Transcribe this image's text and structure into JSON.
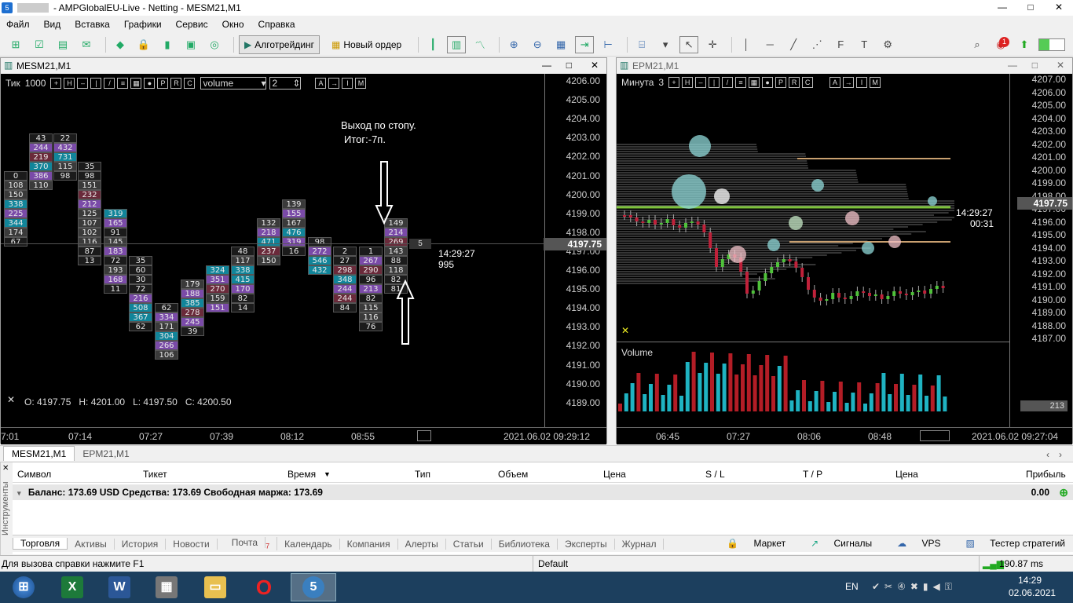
{
  "window": {
    "title": "- AMPGlobalEU-Live - Netting - MESM21,M1",
    "minimize": "—",
    "maximize": "□",
    "close": "✕"
  },
  "menu": [
    "Файл",
    "Вид",
    "Вставка",
    "Графики",
    "Сервис",
    "Окно",
    "Справка"
  ],
  "toolbar": {
    "algo_label": "Алготрейдинг",
    "order_label": "Новый ордер",
    "notif_count": "1"
  },
  "left_chart": {
    "tab": "MESM21,M1",
    "period_label": "Тик",
    "period_value": "1000",
    "indicator_select": "volume",
    "indicator_param": "2",
    "annotation_line1": "Выход по стопу.",
    "annotation_line2": "Итог:-7п.",
    "ohlc": "O: 4197.75   H: 4201.00   L: 4197.50   C: 4200.50",
    "current_price": "4197.75",
    "countdown_time": "14:29:27",
    "countdown_ticks": "995",
    "last_value": "5",
    "price_axis": [
      "4206.00",
      "4205.00",
      "4204.00",
      "4203.00",
      "4202.00",
      "4201.00",
      "4200.00",
      "4199.00",
      "4198.00",
      "4197.00",
      "4196.00",
      "4195.00",
      "4194.00",
      "4193.00",
      "4192.00",
      "4191.00",
      "4190.00",
      "4189.00"
    ],
    "time_axis": [
      "7:01",
      "07:14",
      "07:27",
      "07:39",
      "08:12",
      "08:55"
    ],
    "datetime": "2021.06.02 09:29:12",
    "columns": [
      {
        "vals": [
          "0",
          "108",
          "150",
          "338",
          "225",
          "344",
          "174",
          "67"
        ]
      },
      {
        "vals": [
          "43",
          "244",
          "219",
          "370",
          "386",
          "110"
        ]
      },
      {
        "vals": [
          "22",
          "432",
          "731",
          "115",
          "98"
        ]
      },
      {
        "vals": [
          "35",
          "98",
          "151",
          "232",
          "212",
          "125",
          "107",
          "102",
          "116",
          "87",
          "13"
        ]
      },
      {
        "vals": [
          "319",
          "165",
          "91",
          "145",
          "183",
          "72",
          "193",
          "168",
          "11"
        ]
      },
      {
        "vals": [
          "35",
          "60",
          "30",
          "72",
          "216",
          "508",
          "367",
          "62"
        ]
      },
      {
        "vals": [
          "62",
          "334",
          "171",
          "304",
          "266",
          "106"
        ]
      },
      {
        "vals": [
          "179",
          "188",
          "385",
          "278",
          "245",
          "39"
        ]
      },
      {
        "vals": [
          "324",
          "351",
          "270",
          "159",
          "151"
        ]
      },
      {
        "vals": [
          "48",
          "117",
          "338",
          "415",
          "170",
          "82",
          "14"
        ]
      },
      {
        "vals": [
          "132",
          "218",
          "471",
          "237",
          "150"
        ]
      },
      {
        "vals": [
          "139",
          "155",
          "167",
          "476",
          "319",
          "16"
        ]
      },
      {
        "vals": [
          "98",
          "272",
          "546",
          "432"
        ]
      },
      {
        "vals": [
          "2",
          "27",
          "298",
          "348",
          "244",
          "244",
          "84"
        ]
      },
      {
        "vals": [
          "1",
          "267",
          "290",
          "96",
          "213",
          "82",
          "115",
          "116",
          "76"
        ]
      },
      {
        "vals": [
          "149",
          "214",
          "269",
          "143",
          "88",
          "118",
          "82",
          "81"
        ]
      }
    ]
  },
  "right_chart": {
    "tab": "EPM21,M1",
    "period_label": "Минута",
    "period_value": "3",
    "current_price": "4197.75",
    "countdown_time": "14:29:27",
    "countdown_secs": "00:31",
    "volume_label": "Volume",
    "volume_value": "213",
    "price_axis": [
      "4207.00",
      "4206.00",
      "4205.00",
      "4204.00",
      "4203.00",
      "4202.00",
      "4201.00",
      "4200.00",
      "4199.00",
      "4198.00",
      "4197.00",
      "4196.00",
      "4195.00",
      "4194.00",
      "4193.00",
      "4192.00",
      "4191.00",
      "4190.00",
      "4189.00",
      "4188.00",
      "4187.00"
    ],
    "time_axis": [
      "06:45",
      "07:27",
      "08:06",
      "08:48"
    ],
    "datetime": "2021.06.02 09:27:04"
  },
  "chart_tabs": [
    "MESM21,M1",
    "EPM21,M1"
  ],
  "terminal": {
    "side_label": "Инструменты",
    "headers": [
      "Символ",
      "Тикет",
      "Время",
      "Тип",
      "Объем",
      "Цена",
      "S / L",
      "T / P",
      "Цена",
      "Прибыль"
    ],
    "balance": "Баланс: 173.69 USD  Средства: 173.69  Свободная маржа: 173.69",
    "profit": "0.00",
    "tabs": [
      "Торговля",
      "Активы",
      "История",
      "Новости",
      "Почта",
      "Календарь",
      "Компания",
      "Алерты",
      "Статьи",
      "Библиотека",
      "Эксперты",
      "Журнал"
    ],
    "mail_count": "7",
    "right_links": [
      "Маркет",
      "Сигналы",
      "VPS",
      "Тестер стратегий"
    ]
  },
  "status": {
    "help": "Для вызова справки нажмите F1",
    "profile": "Default",
    "ping": "190.87 ms"
  },
  "taskbar": {
    "lang": "EN",
    "time": "14:29",
    "date": "02.06.2021"
  }
}
